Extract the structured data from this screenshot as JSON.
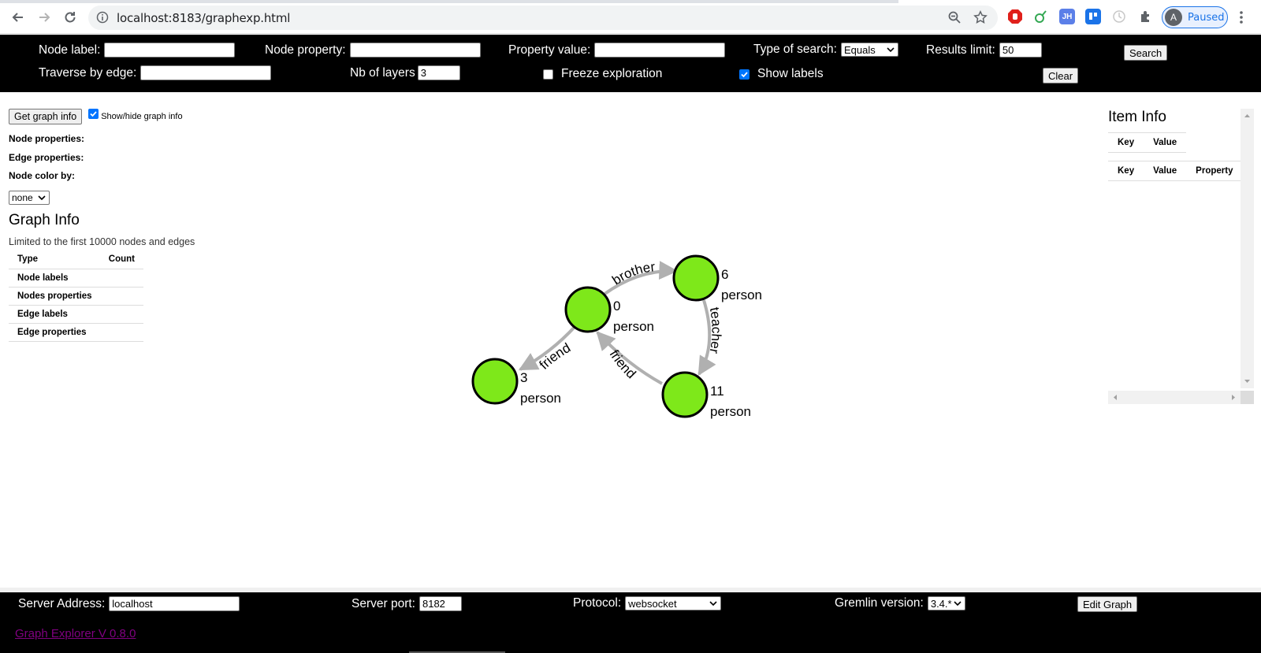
{
  "browser": {
    "url": "localhost:8183/graphexp.html",
    "profile_initial": "A",
    "profile_status": "Paused",
    "extensions": [
      {
        "name": "adblock-icon",
        "color": "#e0201b",
        "label": ""
      },
      {
        "name": "leaf-extension-icon",
        "color": "#ffffff",
        "label": ""
      },
      {
        "name": "jh-extension-icon",
        "color": "#5b7fe8",
        "label": "JH"
      },
      {
        "name": "trello-extension-icon",
        "color": "#1a73e8",
        "label": ""
      },
      {
        "name": "timer-extension-icon",
        "color": "#ffffff",
        "label": ""
      }
    ]
  },
  "search_bar": {
    "node_label": "Node label:",
    "node_label_value": "",
    "node_property": "Node property:",
    "node_property_value": "",
    "property_value": "Property value:",
    "property_value_value": "",
    "type_of_search": "Type of search:",
    "type_of_search_selected": "Equals",
    "results_limit": "Results limit:",
    "results_limit_value": "50",
    "search_button": "Search",
    "traverse_by_edge": "Traverse by edge:",
    "traverse_by_edge_value": "",
    "nb_of_layers": "Nb of layers",
    "nb_of_layers_value": "3",
    "freeze_exploration": "Freeze exploration",
    "freeze_checked": false,
    "show_labels": "Show labels",
    "show_labels_checked": true,
    "clear_button": "Clear"
  },
  "left_panel": {
    "get_graph_info_button": "Get graph info",
    "show_hide_label": "Show/hide graph info",
    "show_hide_checked": true,
    "node_properties": "Node properties:",
    "edge_properties": "Edge properties:",
    "node_color_by": "Node color by:",
    "node_color_selected": "none",
    "graph_info_title": "Graph Info",
    "graph_info_subtitle": "Limited to the first 10000 nodes and edges",
    "table_headers": [
      "Type",
      "Count"
    ],
    "table_rows": [
      "Node labels",
      "Nodes properties",
      "Edge labels",
      "Edge properties"
    ]
  },
  "right_panel": {
    "title": "Item Info",
    "table1_headers": [
      "Key",
      "Value"
    ],
    "table2_headers": [
      "Key",
      "Value",
      "Property"
    ]
  },
  "graph": {
    "node_color": "#7ee81a",
    "edge_color": "#b0b0b0",
    "nodes": [
      {
        "id": "0",
        "label": "person"
      },
      {
        "id": "6",
        "label": "person"
      },
      {
        "id": "3",
        "label": "person"
      },
      {
        "id": "11",
        "label": "person"
      }
    ],
    "edges": [
      {
        "source": "0",
        "target": "6",
        "label": "brother"
      },
      {
        "source": "6",
        "target": "11",
        "label": "teacher"
      },
      {
        "source": "11",
        "target": "0",
        "label": "friend"
      },
      {
        "source": "0",
        "target": "3",
        "label": "friend"
      }
    ]
  },
  "footer": {
    "server_address": "Server Address:",
    "server_address_value": "localhost",
    "server_port": "Server port:",
    "server_port_value": "8182",
    "protocol": "Protocol:",
    "protocol_selected": "websocket",
    "gremlin_version": "Gremlin version:",
    "gremlin_version_selected": "3.4.*",
    "edit_graph_button": "Edit Graph",
    "version_link": "Graph Explorer V 0.8.0"
  }
}
